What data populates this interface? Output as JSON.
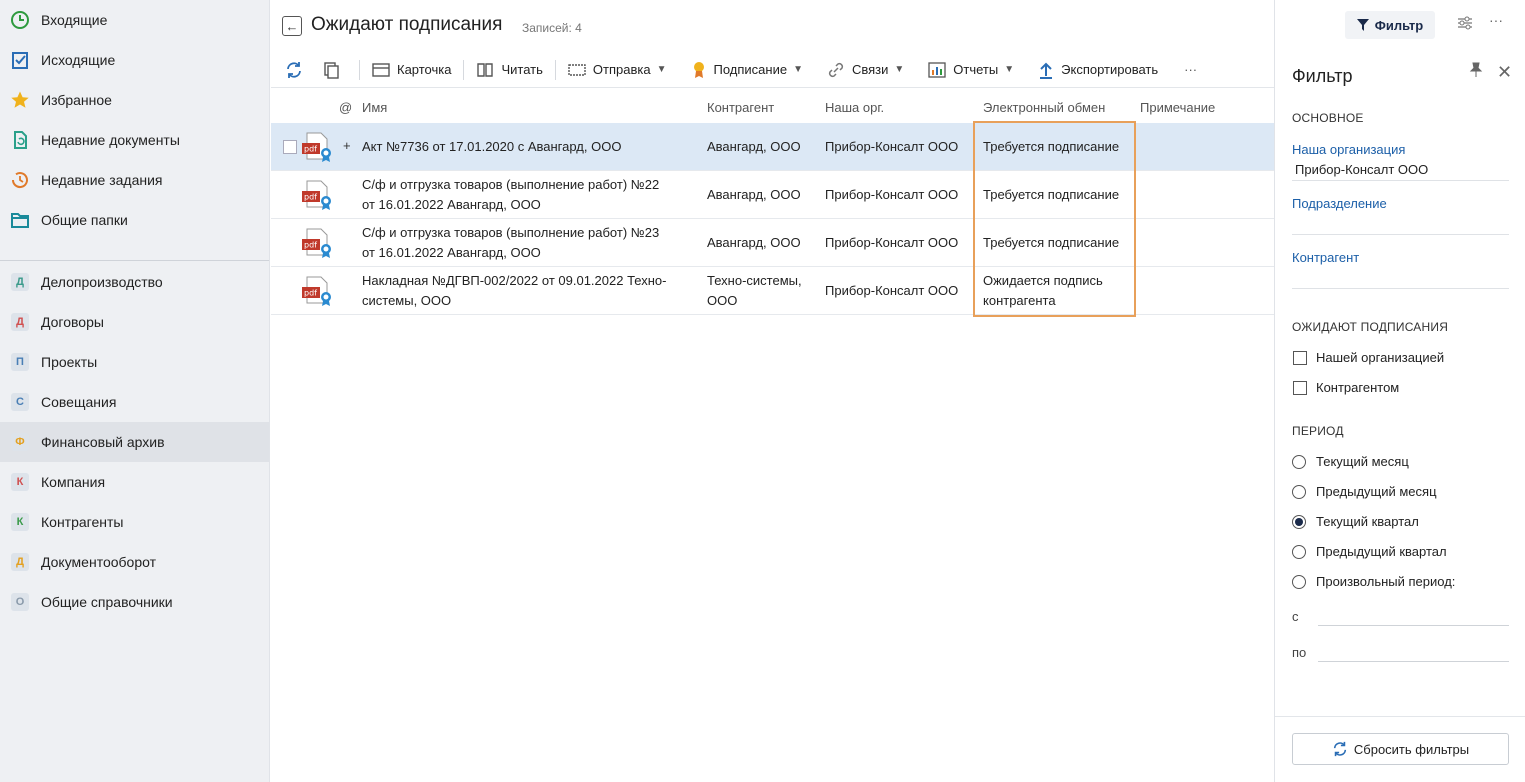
{
  "colors": {
    "accent": "#1c5fa8",
    "highlight": "#e8a05a",
    "selected_row": "#dce8f5"
  },
  "sidebar": {
    "items": [
      {
        "label": "Входящие",
        "icon": "clock-icon"
      },
      {
        "label": "Исходящие",
        "icon": "outbox-icon"
      },
      {
        "label": "Избранное",
        "icon": "star-icon"
      },
      {
        "label": "Недавние документы",
        "icon": "recent-doc-icon"
      },
      {
        "label": "Недавние задания",
        "icon": "recent-task-icon"
      },
      {
        "label": "Общие папки",
        "icon": "folder-icon"
      }
    ],
    "modules": [
      {
        "letter": "Д",
        "label": "Делопроизводство",
        "color": "#3a9a8a"
      },
      {
        "letter": "Д",
        "label": "Договоры",
        "color": "#d05050"
      },
      {
        "letter": "П",
        "label": "Проекты",
        "color": "#4a7fb5"
      },
      {
        "letter": "С",
        "label": "Совещания",
        "color": "#4a7fb5"
      },
      {
        "letter": "Ф",
        "label": "Финансовый архив",
        "color": "#e3a020"
      },
      {
        "letter": "К",
        "label": "Компания",
        "color": "#d05050"
      },
      {
        "letter": "К",
        "label": "Контрагенты",
        "color": "#3a9a4a"
      },
      {
        "letter": "Д",
        "label": "Документооборот",
        "color": "#e3a020"
      },
      {
        "letter": "О",
        "label": "Общие справочники",
        "color": "#8a9aaa"
      }
    ]
  },
  "header": {
    "title": "Ожидают подписания",
    "records": "Записей: 4"
  },
  "toolbar": {
    "card": "Карточка",
    "read": "Читать",
    "send": "Отправка",
    "sign": "Подписание",
    "links": "Связи",
    "reports": "Отчеты",
    "export": "Экспортировать",
    "more": "···"
  },
  "table": {
    "headers": {
      "at": "@",
      "name": "Имя",
      "counterparty": "Контрагент",
      "our_org": "Наша орг.",
      "exchange": "Электронный обмен",
      "note": "Примечание"
    },
    "rows": [
      {
        "plus": "+",
        "name_1": "Акт №7736 от 17.01.2020 с Авангард, ООО",
        "name_2": "",
        "counterparty_1": "Авангард, ООО",
        "counterparty_2": "",
        "our_org": "Прибор-Консалт ООО",
        "exchange_1": "Требуется подписание",
        "exchange_2": ""
      },
      {
        "plus": "",
        "name_1": "С/ф и отгрузка товаров (выполнение работ) №22",
        "name_2": "от 16.01.2022 Авангард, ООО",
        "counterparty_1": "Авангард, ООО",
        "counterparty_2": "",
        "our_org": "Прибор-Консалт ООО",
        "exchange_1": "Требуется подписание",
        "exchange_2": ""
      },
      {
        "plus": "",
        "name_1": "С/ф и отгрузка товаров (выполнение работ) №23",
        "name_2": "от 16.01.2022 Авангард, ООО",
        "counterparty_1": "Авангард, ООО",
        "counterparty_2": "",
        "our_org": "Прибор-Консалт ООО",
        "exchange_1": "Требуется подписание",
        "exchange_2": ""
      },
      {
        "plus": "",
        "name_1": "Накладная №ДГВП-002/2022 от 09.01.2022 Техно-",
        "name_2": "системы, ООО",
        "counterparty_1": "Техно-системы,",
        "counterparty_2": "ООО",
        "our_org": "Прибор-Консалт ООО",
        "exchange_1": "Ожидается подпись",
        "exchange_2": "контрагента"
      }
    ]
  },
  "filter": {
    "button": "Фильтр",
    "title": "Фильтр",
    "main_section": "ОСНОВНОЕ",
    "our_org_label": "Наша организация",
    "our_org_value": "Прибор-Консалт ООО",
    "department_label": "Подразделение",
    "counterparty_label": "Контрагент",
    "awaiting_section": "ОЖИДАЮТ ПОДПИСАНИЯ",
    "by_our_org": "Нашей организацией",
    "by_counterparty": "Контрагентом",
    "period_section": "ПЕРИОД",
    "periods": [
      "Текущий месяц",
      "Предыдущий месяц",
      "Текущий квартал",
      "Предыдущий квартал",
      "Произвольный период:"
    ],
    "selected_period": "Текущий квартал",
    "from_label": "с",
    "to_label": "по",
    "reset": "Сбросить фильтры"
  }
}
